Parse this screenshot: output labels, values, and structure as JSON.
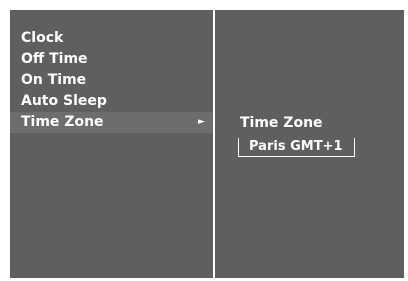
{
  "menu": {
    "items": [
      {
        "label": "Clock"
      },
      {
        "label": "Off Time"
      },
      {
        "label": "On Time"
      },
      {
        "label": "Auto Sleep"
      },
      {
        "label": "Time Zone",
        "selected": true
      }
    ],
    "arrow_glyph": "►"
  },
  "panel": {
    "title": "Time Zone",
    "value": "Paris GMT+1"
  },
  "colors": {
    "background": "#5f5f5f",
    "highlight": "#6d6d6d",
    "text": "#ffffff"
  }
}
